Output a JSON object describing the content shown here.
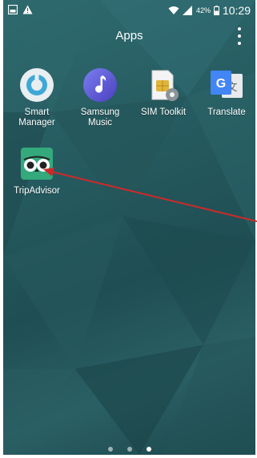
{
  "status_bar": {
    "battery_percent": "42%",
    "time": "10:29",
    "left_icons": [
      "image-notification-icon",
      "warning-icon"
    ],
    "right_icons": [
      "wifi-icon",
      "signal-icon",
      "battery-icon"
    ]
  },
  "header": {
    "title": "Apps",
    "menu_icon": "more-vertical-icon"
  },
  "apps": [
    {
      "label_line1": "Smart",
      "label_line2": "Manager",
      "icon": "smart-manager-icon"
    },
    {
      "label_line1": "Samsung",
      "label_line2": "Music",
      "icon": "samsung-music-icon"
    },
    {
      "label_line1": "SIM Toolkit",
      "label_line2": "",
      "icon": "sim-toolkit-icon"
    },
    {
      "label_line1": "Translate",
      "label_line2": "",
      "icon": "translate-icon"
    },
    {
      "label_line1": "TripAdvisor",
      "label_line2": "",
      "icon": "tripadvisor-icon"
    }
  ],
  "page_indicator": {
    "count": 3,
    "active_index": 2
  },
  "annotation": {
    "color": "#cc2a2a",
    "points_to": "TripAdvisor"
  }
}
